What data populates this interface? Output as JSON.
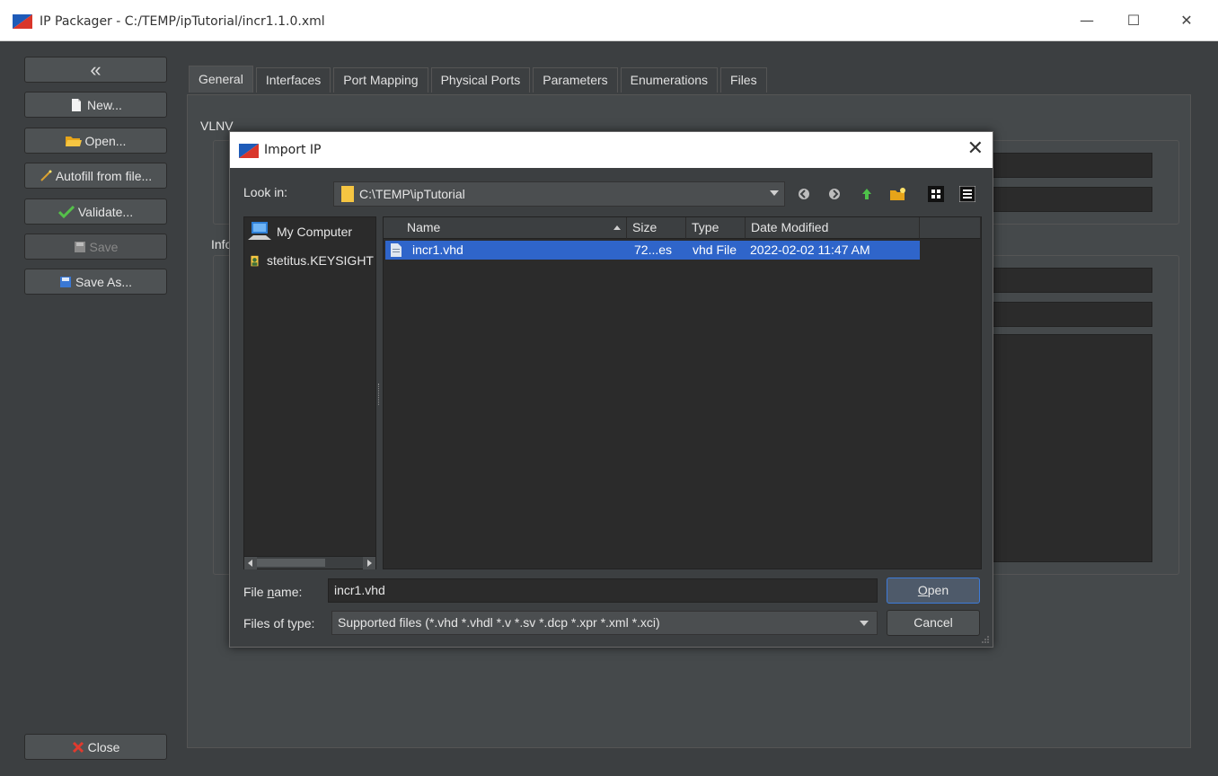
{
  "window": {
    "title": "IP Packager - C:/TEMP/ipTutorial/incr1.1.0.xml",
    "minimize": "—",
    "maximize": "☐",
    "close": "✕"
  },
  "sidebar": {
    "collapse": "«",
    "new": "New...",
    "open": "Open...",
    "autofill": "Autofill from file...",
    "validate": "Validate...",
    "save": "Save",
    "save_as": "Save As...",
    "close": "Close"
  },
  "tabs": [
    "General",
    "Interfaces",
    "Port Mapping",
    "Physical Ports",
    "Parameters",
    "Enumerations",
    "Files"
  ],
  "general": {
    "vlnv_label": "VLNV",
    "info_label": "Info"
  },
  "dialog": {
    "title": "Import IP",
    "close": "✕",
    "look_in_label": "Look in:",
    "look_in_value": "C:\\TEMP\\ipTutorial",
    "places": [
      "My Computer",
      "stetitus.KEYSIGHT"
    ],
    "columns": [
      "Name",
      "Size",
      "Type",
      "Date Modified"
    ],
    "files": [
      {
        "name": "incr1.vhd",
        "size": "72...es",
        "type": "vhd File",
        "modified": "2022-02-02 11:47 AM"
      }
    ],
    "file_name_label_pre": "File ",
    "file_name_label_u": "n",
    "file_name_label_post": "ame:",
    "file_name_value": "incr1.vhd",
    "files_of_type_label": "Files of type:",
    "files_of_type_value": "Supported files (*.vhd *.vhdl *.v *.sv *.dcp *.xpr *.xml *.xci)",
    "open_button_u": "O",
    "open_button_rest": "pen",
    "cancel_button": "Cancel"
  },
  "colors": {
    "background": "#3c3f41",
    "field": "#2b2b2b",
    "selection": "#2f65ca"
  }
}
